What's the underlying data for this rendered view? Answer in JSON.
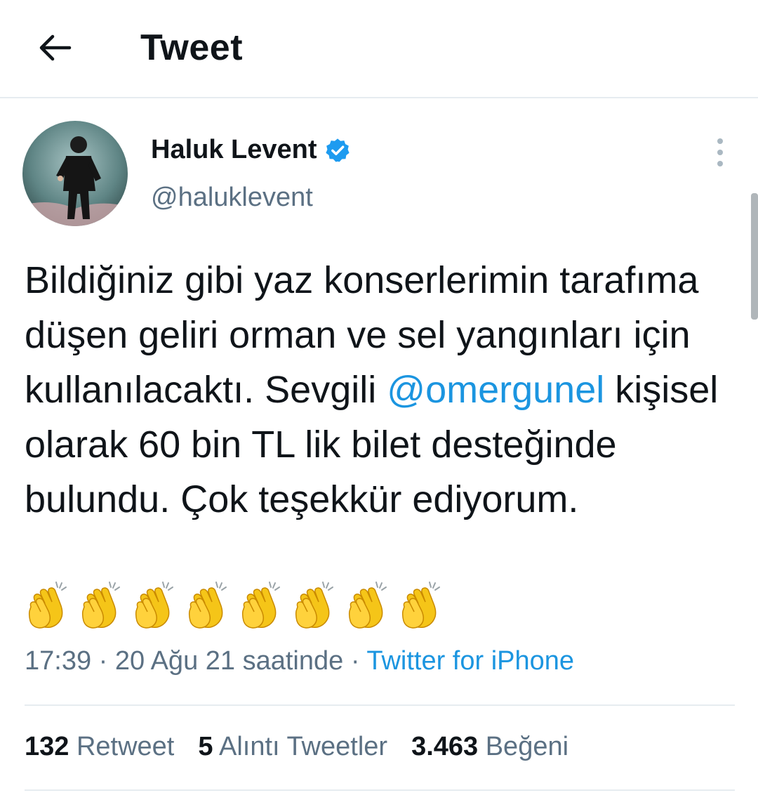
{
  "header": {
    "title": "Tweet",
    "back_icon": "arrow-left-icon"
  },
  "author": {
    "name": "Haluk Levent",
    "handle": "@haluklevent",
    "verified": true
  },
  "tweet": {
    "text_before_mention": "Bildiğiniz gibi yaz konserlerimin tarafıma düşen geliri orman ve sel yangınları için kullanılacaktı. Sevgili ",
    "mention": "@omergunel",
    "text_after_mention": " kişisel olarak 60 bin TL lik bilet desteğinde bulundu. Çok teşekkür ediyorum.",
    "emoji_count": 8,
    "emoji": "clapping-hands-icon"
  },
  "meta": {
    "timestamp": "17:39 · 20 Ağu 21 saatinde · ",
    "source": "Twitter for iPhone"
  },
  "stats": {
    "retweets_count": "132",
    "retweets_label": " Retweet",
    "quotes_count": "5",
    "quotes_label": " Alıntı Tweetler",
    "likes_count": "3.463",
    "likes_label": " Beğeni"
  },
  "colors": {
    "link": "#1b95e0",
    "secondary_text": "#5b7083",
    "verified": "#1d9bf0",
    "divider": "#e6ecf0"
  }
}
